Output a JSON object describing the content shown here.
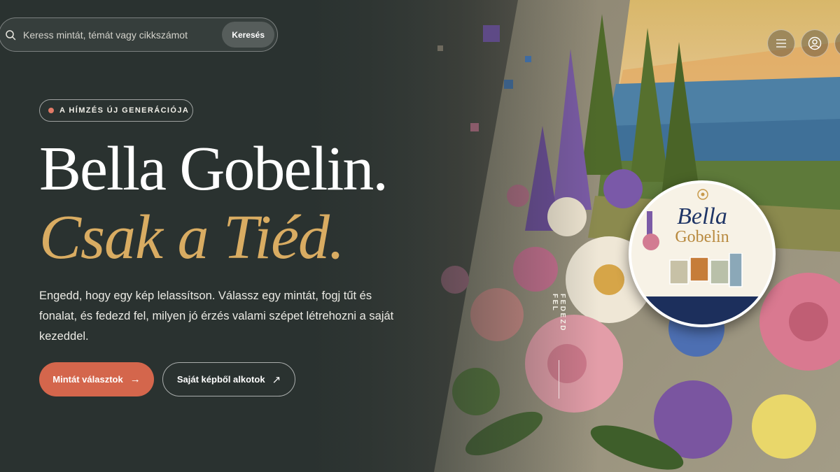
{
  "search": {
    "placeholder": "Keress mintát, témát vagy cikkszámot",
    "button_label": "Keresés"
  },
  "header": {
    "menu_icon": "hamburger-icon",
    "user_icon": "user-icon"
  },
  "hero": {
    "tagline": "A HÍMZÉS ÚJ GENERÁCIÓJA",
    "title_line1": "Bella Gobelin.",
    "title_line2": "Csak a Tiéd.",
    "description": "Engedd, hogy egy kép lelassítson. Válassz egy mintát, fogj tűt és fonalat, és fedezd fel, milyen jó érzés valami szépet létrehozni a saját kezeddel.",
    "cta_primary": "Mintát választok",
    "cta_primary_icon": "arrow-right-icon",
    "cta_secondary": "Saját képből alkotok",
    "cta_secondary_icon": "arrow-up-right-icon",
    "scroll_label": "FEDEZD FEL"
  },
  "badge": {
    "line1": "Bella",
    "line2": "Gobelin"
  },
  "colors": {
    "accent": "#d4664c",
    "gold": "#d9ac62",
    "background": "#2a3230",
    "badge_navy": "#1c2f5c"
  }
}
